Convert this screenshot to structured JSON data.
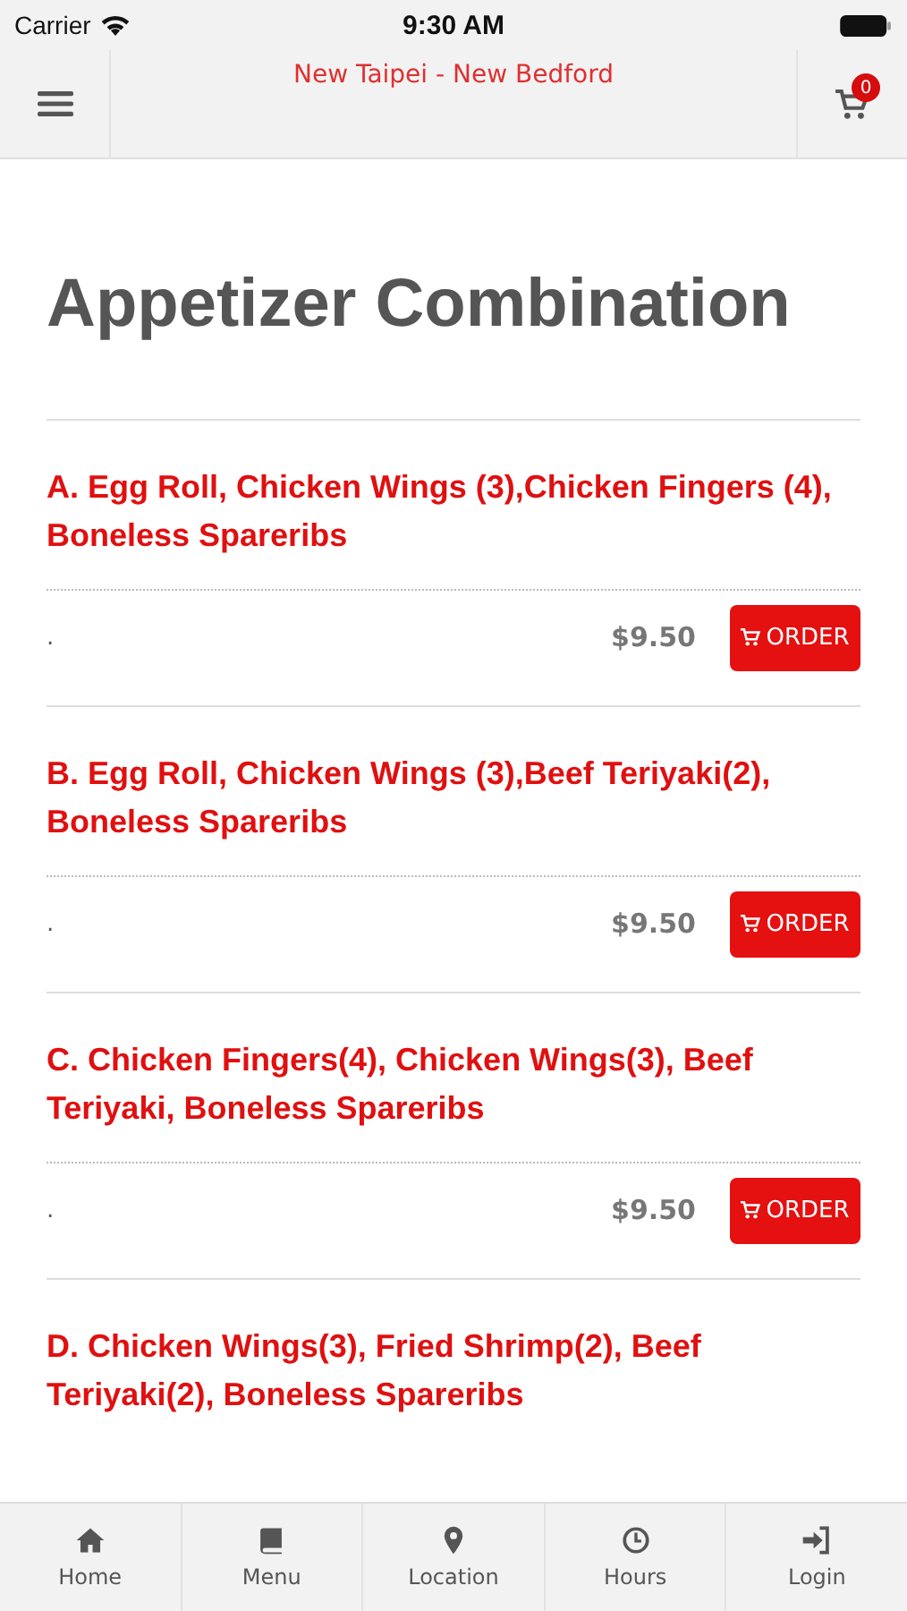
{
  "status_bar": {
    "carrier": "Carrier",
    "time": "9:30 AM"
  },
  "header": {
    "title": "New Taipei - New Bedford",
    "cart_count": "0"
  },
  "page_title": "Appetizer Combination",
  "items": [
    {
      "name": "A. Egg Roll, Chicken Wings (3),Chicken Fingers (4), Boneless Spareribs",
      "description": ".",
      "price": "$9.50",
      "button": "ORDER"
    },
    {
      "name": "B. Egg Roll, Chicken Wings (3),Beef Teriyaki(2), Boneless Spareribs",
      "description": ".",
      "price": "$9.50",
      "button": "ORDER"
    },
    {
      "name": "C. Chicken Fingers(4), Chicken Wings(3), Beef Teriyaki, Boneless Spareribs",
      "description": ".",
      "price": "$9.50",
      "button": "ORDER"
    },
    {
      "name": "D. Chicken Wings(3), Fried Shrimp(2), Beef Teriyaki(2), Boneless Spareribs"
    }
  ],
  "tab_bar": [
    {
      "label": "Home"
    },
    {
      "label": "Menu"
    },
    {
      "label": "Location"
    },
    {
      "label": "Hours"
    },
    {
      "label": "Login"
    }
  ]
}
